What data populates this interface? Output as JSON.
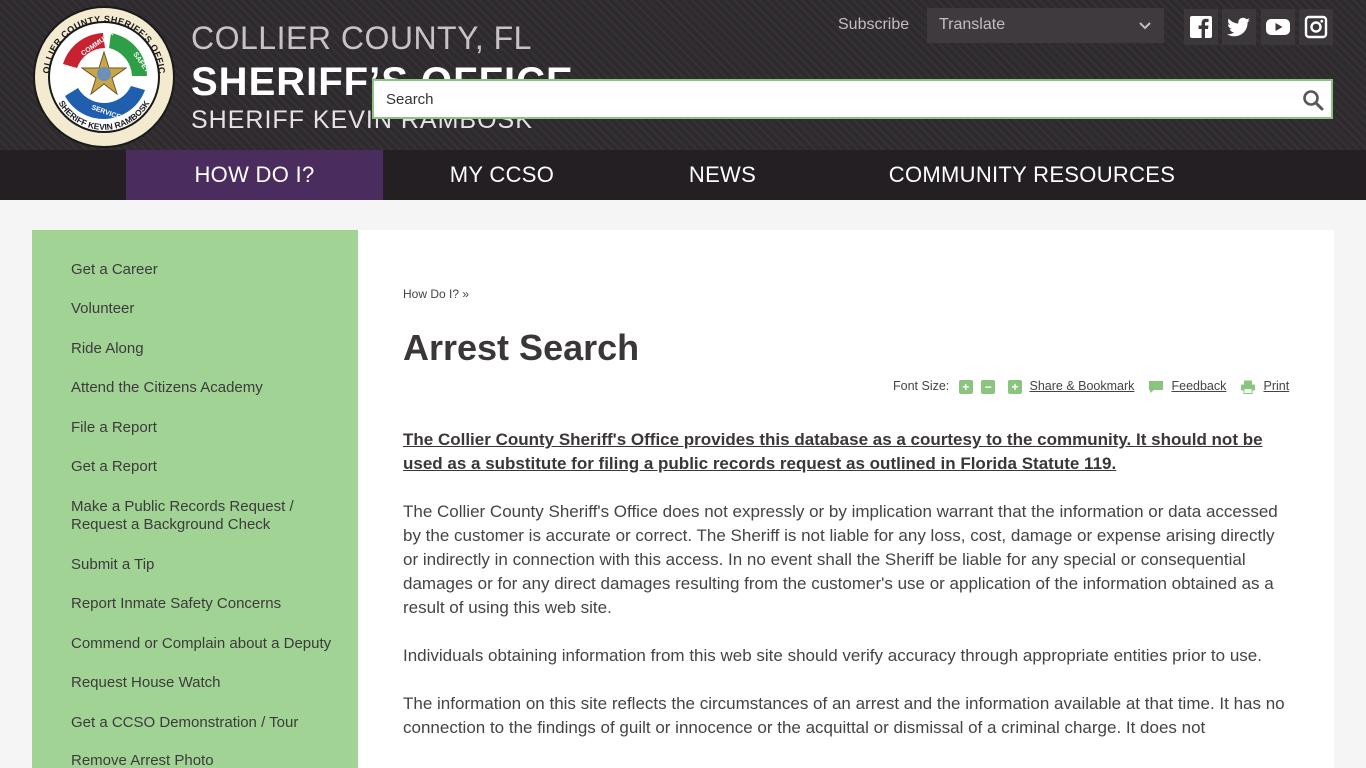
{
  "header": {
    "seal_text": {
      "top": "COLLIER COUNTY SHERIFF'S OFFICE",
      "bottom": "SHERIFF KEVIN RAMBOSK",
      "community": "COMMUNITY",
      "safety": "SAFETY",
      "service": "SERVICE"
    },
    "brand_line1": "COLLIER COUNTY, FL",
    "brand_line2": "SHERIFF’S OFFICE",
    "brand_line3": "SHERIFF KEVIN RAMBOSK",
    "subscribe_label": "Subscribe",
    "translate_label": "Translate",
    "social": [
      {
        "name": "facebook-icon"
      },
      {
        "name": "twitter-icon"
      },
      {
        "name": "youtube-icon"
      },
      {
        "name": "instagram-icon"
      }
    ],
    "search_placeholder": "Search"
  },
  "nav": {
    "items": [
      {
        "label": "HOW DO I?",
        "active": true
      },
      {
        "label": "MY CCSO"
      },
      {
        "label": "NEWS"
      },
      {
        "label": "COMMUNITY RESOURCES"
      }
    ]
  },
  "sidebar": {
    "items": [
      "Get a Career",
      "Volunteer",
      "Ride Along",
      "Attend the Citizens Academy",
      "File a Report",
      "Get a Report",
      "Make a Public Records Request / Request a Background Check",
      "Submit a Tip",
      "Report Inmate Safety Concerns",
      "Commend or Complain about a Deputy",
      "Request House Watch",
      "Get a CCSO Demonstration / Tour",
      "Remove Arrest Photo"
    ]
  },
  "main": {
    "breadcrumb": "How Do I? »",
    "title": "Arrest Search",
    "tools": {
      "font_size_label": "Font Size:",
      "share_label": "Share & Bookmark",
      "feedback_label": "Feedback",
      "print_label": "Print"
    },
    "lead": "The Collier County Sheriff's Office provides this database as a courtesy to the community. It should not be used as a substitute for filing a public records request as outlined in Florida Statute 119.",
    "paragraphs": [
      "The Collier County Sheriff's Office does not expressly or by implication warrant that the information or data accessed by the customer is accurate or correct. The Sheriff is not liable for any loss, cost, damage or expense arising directly or indirectly in connection with this access. In no event shall the Sheriff be liable for any special or consequential damages or for any direct damages resulting from the customer's use or application of the information obtained as a result of using this web site.",
      "Individuals obtaining information from this web site should verify accuracy through appropriate entities prior to use.",
      "The information on this site reflects the circumstances of an arrest and the information available at that time. It has no connection to the findings of guilt or innocence or the acquittal or dismissal of a criminal charge. It does not"
    ]
  },
  "colors": {
    "header_bg": "#2e2a2e",
    "nav_bg": "#231f23",
    "nav_active": "#4b2c5e",
    "sidebar_bg": "#a1d394",
    "accent_green": "#8bc47f"
  }
}
